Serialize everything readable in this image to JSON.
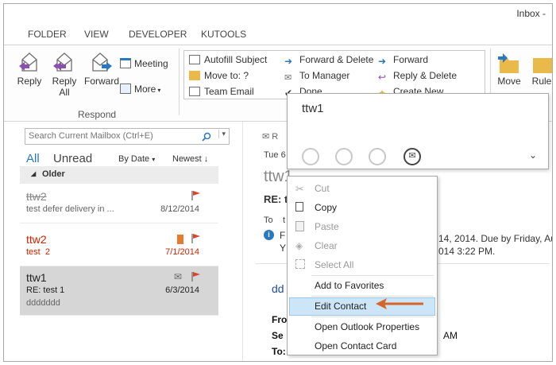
{
  "window": {
    "title": "Inbox -"
  },
  "ribbon_tabs": [
    "FOLDER",
    "VIEW",
    "DEVELOPER",
    "KUTOOLS"
  ],
  "respond": {
    "reply": "Reply",
    "reply_all_1": "Reply",
    "reply_all_2": "All",
    "forward": "Forward",
    "meeting": "Meeting",
    "more": "More",
    "group_label": "Respond"
  },
  "quick_steps": {
    "col1": [
      "Autofill Subject",
      "Move to: ?",
      "Team Email"
    ],
    "col2": [
      "Forward & Delete",
      "To Manager",
      "Done"
    ],
    "col3": [
      "Forward",
      "Reply & Delete",
      "Create New"
    ]
  },
  "move_group": {
    "move": "Move",
    "rules": "Rule"
  },
  "search": {
    "placeholder": "Search Current Mailbox (Ctrl+E)"
  },
  "filters": {
    "all": "All",
    "unread": "Unread",
    "sort": "By Date",
    "order": "Newest"
  },
  "group_header": "Older",
  "mails": [
    {
      "from": "ttw2",
      "subject": "test defer delivery in ...",
      "date": "8/12/2014"
    },
    {
      "from": "ttw2",
      "subject": "test",
      "count": "2",
      "date": "7/1/2014"
    },
    {
      "from": "ttw1",
      "subject": "RE: test 1",
      "preview": "ddddddd",
      "date": "6/3/2014"
    }
  ],
  "reading": {
    "reply_glyph": "R",
    "date_prefix": "Tue 6",
    "from_partial": "ttw1",
    "subject_partial": "RE: t",
    "to_label": "To",
    "to_partial": "t",
    "info_1": "F",
    "info_2": "Y",
    "info_right_1": "14, 2014.  Due by Friday, Au",
    "info_right_2": "014 3:22 PM.",
    "body_link": "dd",
    "header_from": "Fro",
    "header_sent": "Se",
    "header_sent_right": "AM",
    "header_to": "To:"
  },
  "contact_card": {
    "name": "ttw1"
  },
  "context_menu": {
    "items": [
      "Cut",
      "Copy",
      "Paste",
      "Clear",
      "Select All",
      "Add to Favorites",
      "Edit Contact",
      "Open Outlook Properties",
      "Open Contact Card"
    ]
  },
  "colors": {
    "accent": "#2b78c2",
    "flag": "#d9442b",
    "unread_red": "#cc2200",
    "arrow": "#d5652c"
  }
}
